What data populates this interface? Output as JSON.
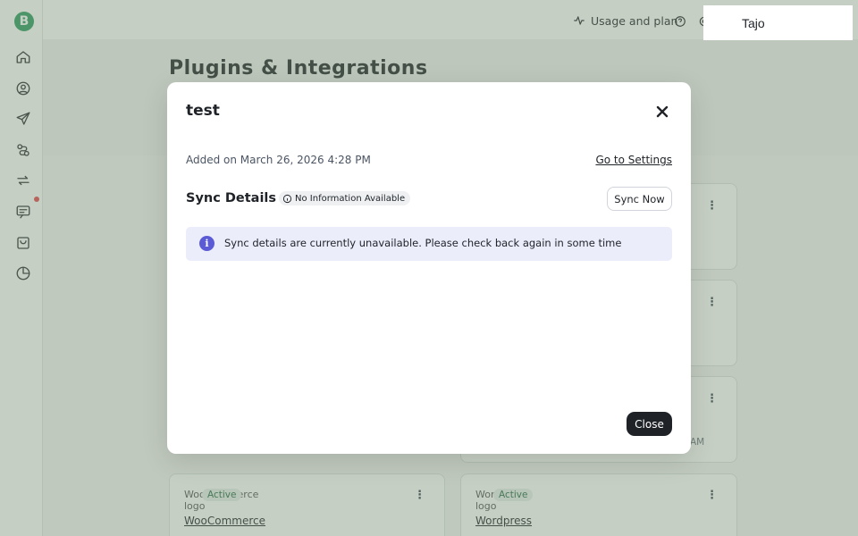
{
  "topbar": {
    "usage_label": "Usage and plan",
    "user_name": "Tajo"
  },
  "page": {
    "title": "Plugins & Integrations"
  },
  "sidebar": {
    "logo_letter": "B",
    "items": [
      {
        "icon": "home-icon"
      },
      {
        "icon": "user-circle-icon"
      },
      {
        "icon": "send-icon"
      },
      {
        "icon": "workflow-icon"
      },
      {
        "icon": "sync-icon"
      },
      {
        "icon": "chat-icon"
      },
      {
        "icon": "bag-icon"
      },
      {
        "icon": "pie-chart-icon"
      }
    ]
  },
  "background_cards": [
    {
      "status": "Active",
      "logo_alt": "WooCommerce logo",
      "name": "WooCommerce"
    },
    {
      "status": "Active",
      "logo_alt": "Wordpress logo",
      "name": "Wordpress"
    },
    {
      "meta_fragment": "AM"
    }
  ],
  "modal": {
    "title": "test",
    "added_on": "Added on March 26, 2026 4:28 PM",
    "go_to_settings": "Go to Settings",
    "sync_details_title": "Sync Details",
    "sync_status_badge": "No Information Available",
    "sync_now_label": "Sync Now",
    "alert_text": "Sync details are currently unavailable. Please check back again in some time",
    "alert_icon_glyph": "i",
    "close_label": "Close"
  },
  "colors": {
    "accent": "#2e9b63",
    "overlay": "#8c9c88",
    "alert_bg": "#ecedfb",
    "alert_icon": "#5b5bd6",
    "primary_button": "#1f2328",
    "notification_dot": "#e5484d"
  }
}
